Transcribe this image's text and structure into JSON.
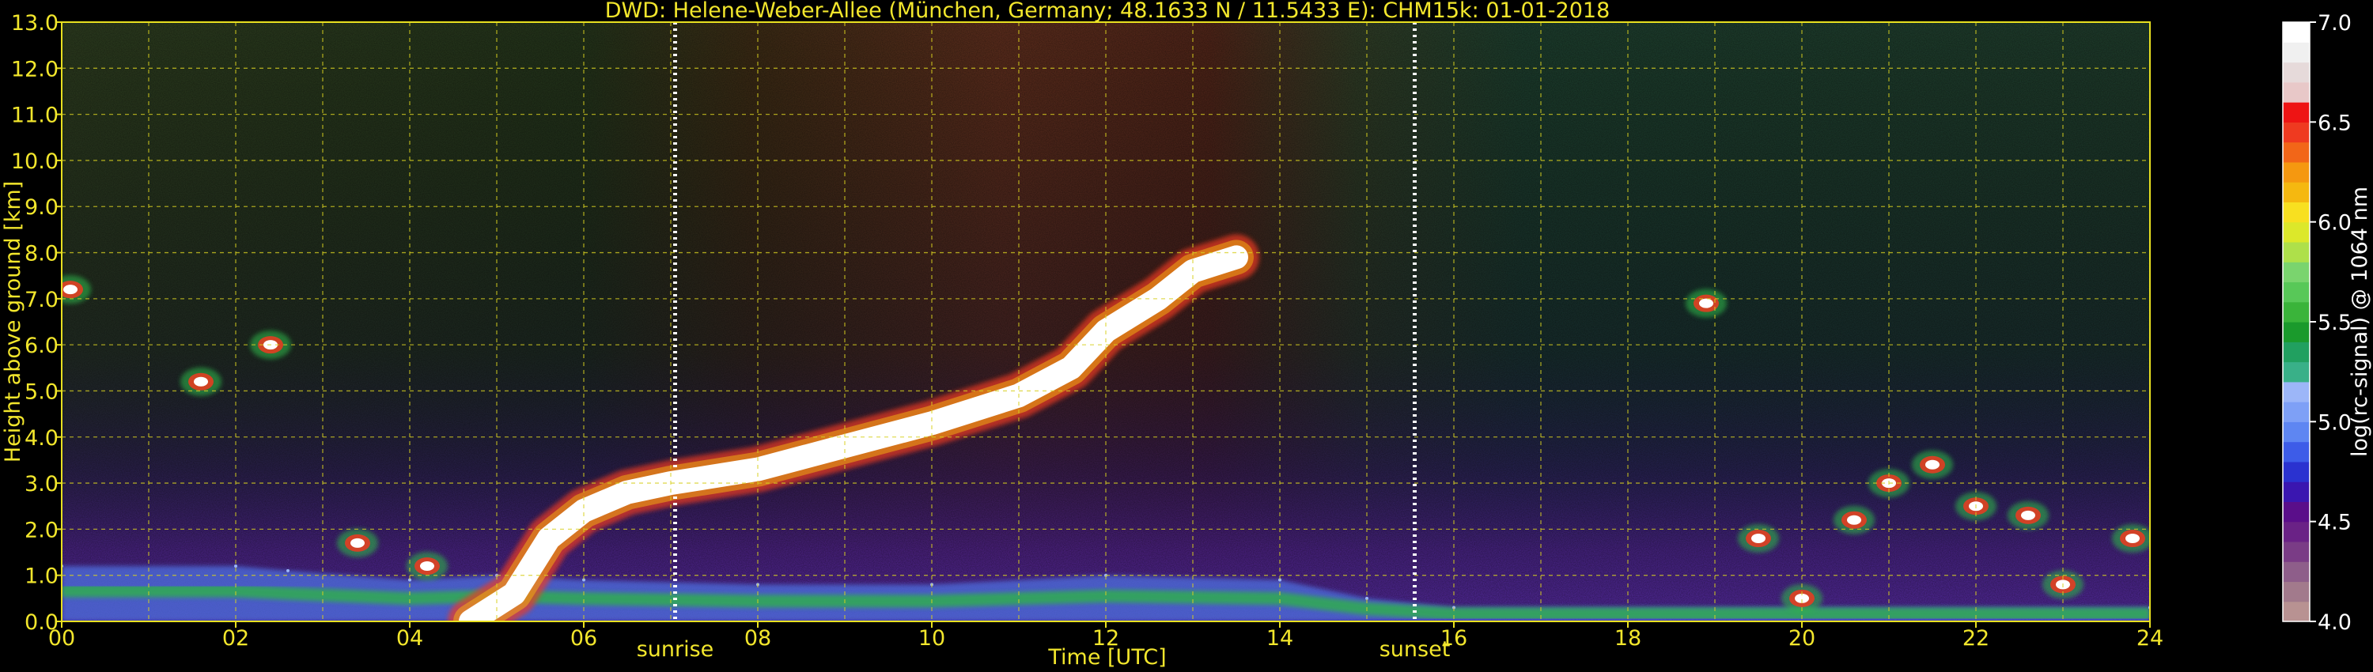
{
  "chart_data": {
    "type": "heatmap",
    "title": "DWD: Helene-Weber-Allee (München, Germany; 48.1633 N / 11.5433 E):    CHM15k: 01-01-2018",
    "xlabel": "Time [UTC]",
    "ylabel": "Height above ground [km]",
    "xlim": [
      0,
      24
    ],
    "ylim": [
      0,
      13
    ],
    "x_ticks": [
      "00",
      "02",
      "04",
      "06",
      "08",
      "10",
      "12",
      "14",
      "16",
      "18",
      "20",
      "22",
      "24"
    ],
    "y_ticks": [
      "0.0",
      "1.0",
      "2.0",
      "3.0",
      "4.0",
      "5.0",
      "6.0",
      "7.0",
      "8.0",
      "9.0",
      "10.0",
      "11.0",
      "12.0",
      "13.0"
    ],
    "grid": true,
    "markers": [
      {
        "label": "sunrise",
        "x": 7.05
      },
      {
        "label": "sunset",
        "x": 15.55
      }
    ],
    "colorbar": {
      "label": "log(rc-signal) @ 1064 nm",
      "range": [
        4.0,
        7.0
      ],
      "ticks": [
        "4.0",
        "4.5",
        "5.0",
        "5.5",
        "6.0",
        "6.5",
        "7.0"
      ],
      "colors": [
        "#b89292",
        "#a27a8c",
        "#8e5e8a",
        "#7a3c86",
        "#6a2286",
        "#5a0e8a",
        "#3a16b0",
        "#2a32d0",
        "#3d5ce8",
        "#5e86f2",
        "#7ea0f6",
        "#9cb6f8",
        "#39b088",
        "#21a060",
        "#1a9a2c",
        "#3ab43a",
        "#58c858",
        "#7ad46e",
        "#aee04a",
        "#dce82a",
        "#f8e020",
        "#f5b810",
        "#f59810",
        "#f26618",
        "#ef3a20",
        "#ee1414",
        "#e8c8c8",
        "#e6dada",
        "#f0f0f0",
        "#ffffff"
      ]
    },
    "series": [
      {
        "name": "",
        "kind": "aerosol_layer",
        "values": [
          [
            0.0,
            1.2
          ],
          [
            2.0,
            1.2
          ],
          [
            2.6,
            1.1
          ],
          [
            4.0,
            0.9
          ],
          [
            5.0,
            1.0
          ],
          [
            6.0,
            0.9
          ],
          [
            8.0,
            0.8
          ],
          [
            10.0,
            0.8
          ],
          [
            12.0,
            1.0
          ],
          [
            14.0,
            0.9
          ],
          [
            15.0,
            0.5
          ],
          [
            16.0,
            0.3
          ],
          [
            24.0,
            0.3
          ]
        ]
      },
      {
        "name": "",
        "kind": "cloud_layer",
        "values": [
          [
            4.7,
            0.0
          ],
          [
            5.2,
            0.6
          ],
          [
            5.6,
            1.8
          ],
          [
            6.0,
            2.4
          ],
          [
            6.5,
            2.8
          ],
          [
            7.0,
            3.0
          ],
          [
            8.0,
            3.3
          ],
          [
            9.0,
            3.8
          ],
          [
            10.0,
            4.3
          ],
          [
            11.0,
            4.9
          ],
          [
            11.6,
            5.5
          ],
          [
            12.0,
            6.3
          ],
          [
            12.6,
            7.0
          ],
          [
            13.0,
            7.6
          ],
          [
            13.5,
            7.9
          ]
        ]
      },
      {
        "name": "",
        "kind": "cloud_patch",
        "values": [
          [
            0.1,
            7.2
          ],
          [
            1.6,
            5.2
          ],
          [
            2.4,
            6.0
          ],
          [
            3.4,
            1.7
          ],
          [
            4.2,
            1.2
          ],
          [
            18.9,
            6.9
          ],
          [
            19.5,
            1.8
          ],
          [
            20.0,
            0.5
          ],
          [
            20.6,
            2.2
          ],
          [
            21.0,
            3.0
          ],
          [
            21.5,
            3.4
          ],
          [
            22.0,
            2.5
          ],
          [
            22.6,
            2.3
          ],
          [
            23.0,
            0.8
          ],
          [
            23.8,
            1.8
          ]
        ]
      }
    ]
  }
}
